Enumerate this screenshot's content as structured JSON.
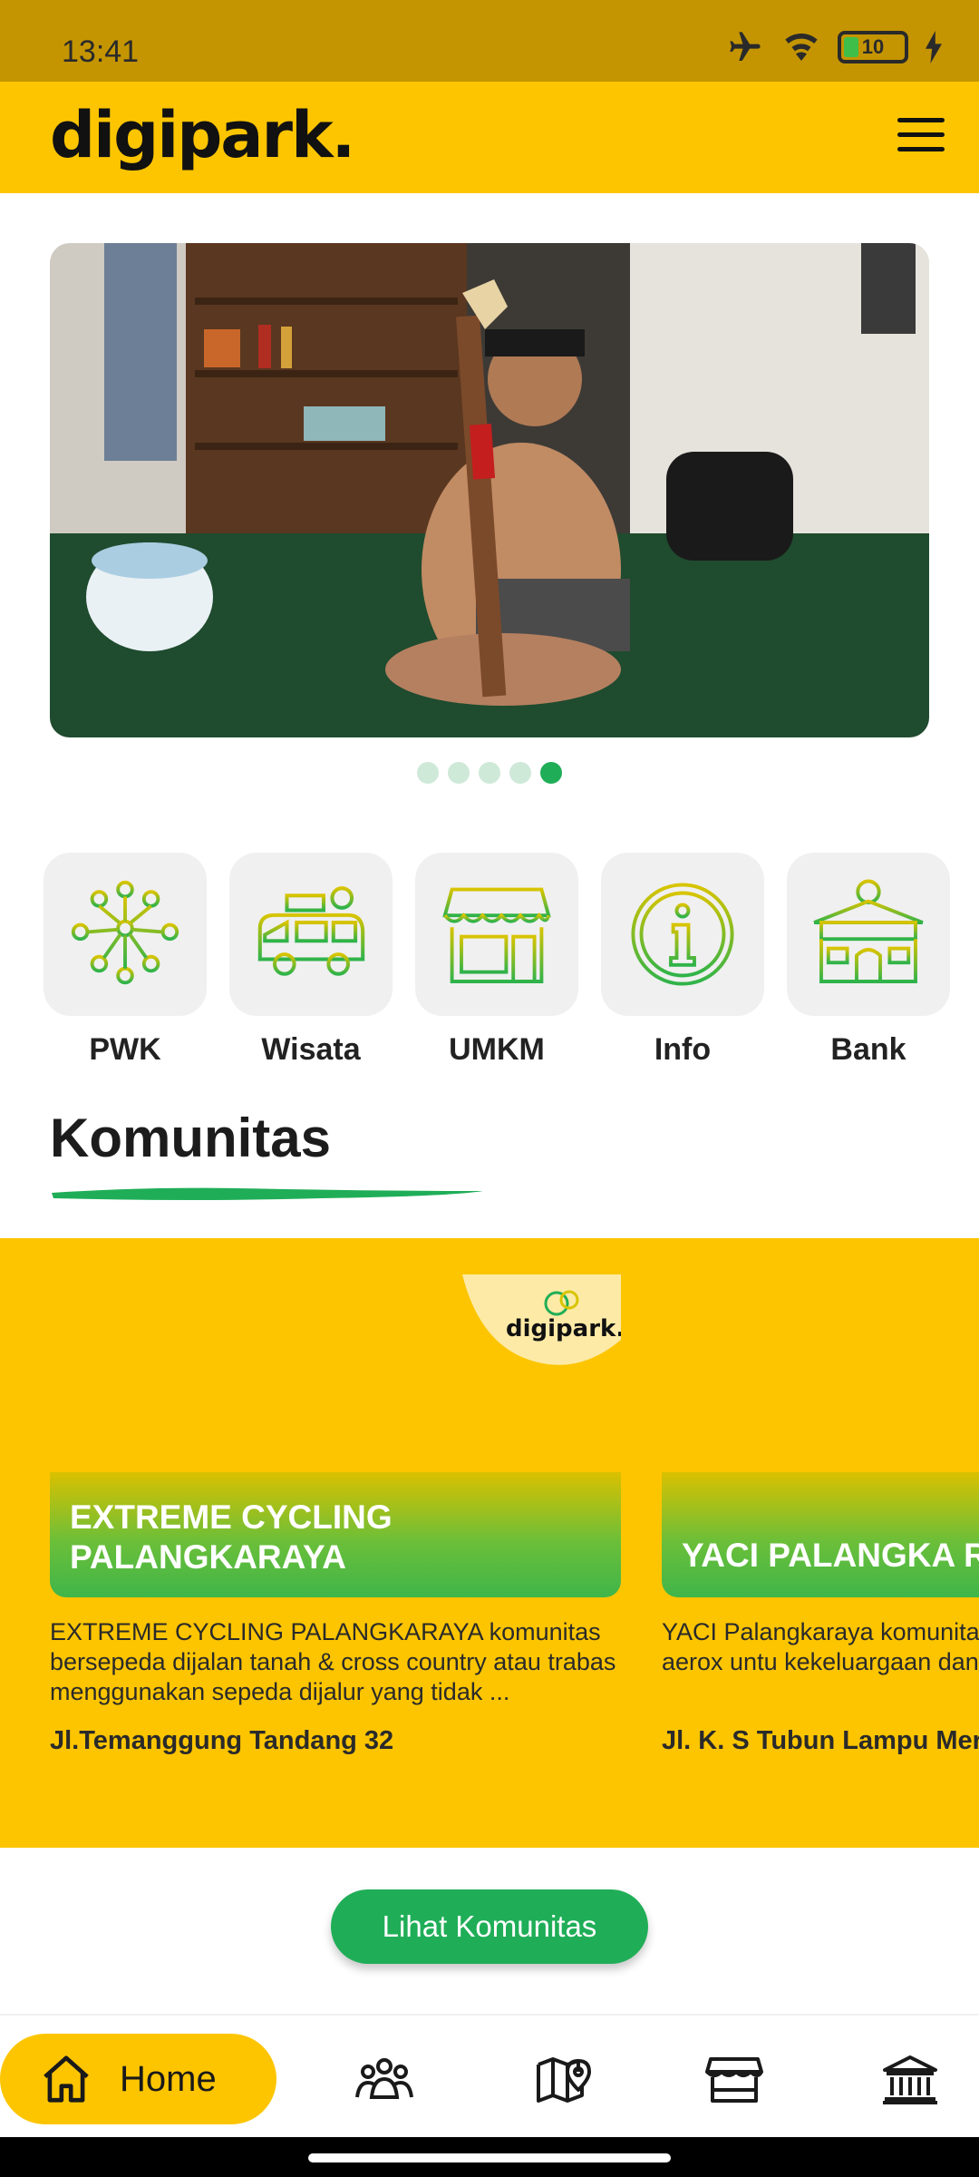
{
  "status_bar": {
    "time": "13:41",
    "battery": "10"
  },
  "header": {
    "logo_text": "digipark."
  },
  "banner": {
    "slide_count": 5,
    "active_slide": 5
  },
  "categories": [
    {
      "label": "PWK",
      "icon": "community-network-icon"
    },
    {
      "label": "Wisata",
      "icon": "travel-van-icon"
    },
    {
      "label": "UMKM",
      "icon": "storefront-icon"
    },
    {
      "label": "Info",
      "icon": "info-icon"
    },
    {
      "label": "Bank",
      "icon": "bank-icon"
    }
  ],
  "komunitas": {
    "title": "Komunitas",
    "cards": [
      {
        "thumb_logo": "digipark.",
        "title": "EXTREME CYCLING PALANGKARAYA",
        "description": "EXTREME CYCLING PALANGKARAYA komunitas bersepeda dijalan tanah & cross country atau trabas menggunakan sepeda dijalur yang tidak ...",
        "address": "Jl.Temanggung Tandang 32"
      },
      {
        "title": "YACI PALANGKA R",
        "description": "YACI Palangkaraya komunita sesama pengguna aerox untu kekeluargaan dan berbagi cir",
        "address": "Jl. K. S Tubun Lampu Mer"
      }
    ],
    "cta_label": "Lihat Komunitas"
  },
  "bottom_nav": {
    "home_label": "Home"
  },
  "colors": {
    "brand_yellow": "#fdc500",
    "brand_green": "#1fae57",
    "status_bar": "#c49500"
  }
}
